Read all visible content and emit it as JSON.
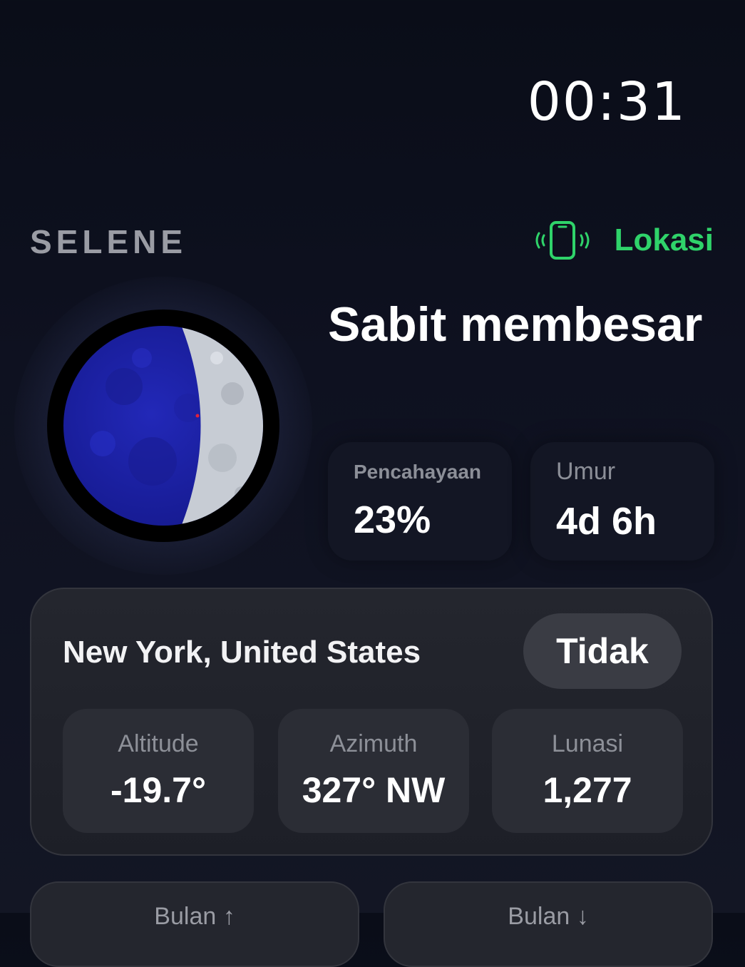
{
  "status": {
    "time": "00:31"
  },
  "header": {
    "brand": "SELENE",
    "location_button": {
      "label": "Lokasi",
      "icon": "phone-vibrate-icon",
      "color": "#2fd36a"
    }
  },
  "moon": {
    "phase_name": "Sabit membesar",
    "illumination": {
      "label": "Pencahayaan",
      "value": "23%"
    },
    "age": {
      "label": "Umur",
      "value": "4d 6h"
    }
  },
  "location": {
    "city": "New York, United States",
    "pill_label": "Tidak",
    "stats": [
      {
        "label": "Altitude",
        "value": "-19.7°"
      },
      {
        "label": "Azimuth",
        "value": "327° NW"
      },
      {
        "label": "Lunasi",
        "value": "1,277"
      }
    ]
  },
  "bottom": {
    "rise_label": "Bulan ↑",
    "set_label": "Bulan ↓"
  },
  "colors": {
    "accent": "#2fd36a",
    "moon_dark": "#1a1fa6",
    "moon_lit": "#c7ccd4"
  }
}
